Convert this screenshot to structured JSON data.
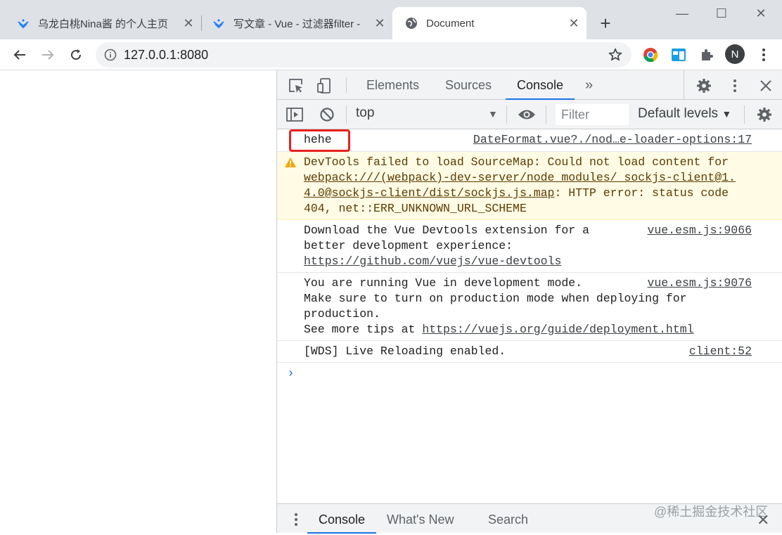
{
  "tabs": [
    {
      "title": "乌龙白桃Nina酱 的个人主页",
      "favicon": "juejin-icon",
      "close": "✕"
    },
    {
      "title": "写文章 - Vue - 过滤器filter -",
      "favicon": "juejin-icon",
      "close": "✕"
    },
    {
      "title": "Document",
      "favicon": "globe-icon",
      "close": "✕"
    }
  ],
  "new_tab": "+",
  "window": {
    "minimize": "—",
    "maximize": "☐",
    "close": "✕"
  },
  "address": {
    "url": "127.0.0.1:8080"
  },
  "profile": {
    "initial": "N"
  },
  "devtools": {
    "tabs": {
      "elements": "Elements",
      "sources": "Sources",
      "console": "Console",
      "more": "»"
    },
    "console_bar": {
      "context": "top",
      "filter_placeholder": "Filter",
      "levels": "Default levels"
    },
    "messages": {
      "m1": {
        "text": "hehe",
        "source": "DateFormat.vue?./nod…e-loader-options:17"
      },
      "m2": {
        "l1_pre": "DevTools failed to load SourceMap: Could not load content for",
        "l2_link": "webpack:///(webpack)-dev-server/node_modules/_sockjs-client@1.",
        "l3_link": "4.0@sockjs-client/dist/sockjs.js.map",
        "l3_post": ": HTTP error: status code",
        "l4": "404, net::ERR_UNKNOWN_URL_SCHEME"
      },
      "m3": {
        "l1": "Download the Vue Devtools extension for a",
        "l2": "better development experience:",
        "l3_link": "https://github.com/vuejs/vue-devtools",
        "source": "vue.esm.js:9066"
      },
      "m4": {
        "l1": "You are running Vue in development mode.",
        "l2": "Make sure to turn on production mode when deploying for",
        "l3": "production.",
        "l4_pre": "See more tips at ",
        "l4_link": "https://vuejs.org/guide/deployment.html",
        "source": "vue.esm.js:9076"
      },
      "m5": {
        "text": "[WDS] Live Reloading enabled.",
        "source": "client:52"
      }
    },
    "prompt": "›",
    "drawer": {
      "console": "Console",
      "whats_new": "What's New",
      "search": "Search",
      "watermark": "@稀土掘金技术社区",
      "close": "✕"
    }
  },
  "colors": {
    "accent": "#1a73e8",
    "highlight_box": "#e8201e",
    "warning_bg": "#fffbe5"
  }
}
